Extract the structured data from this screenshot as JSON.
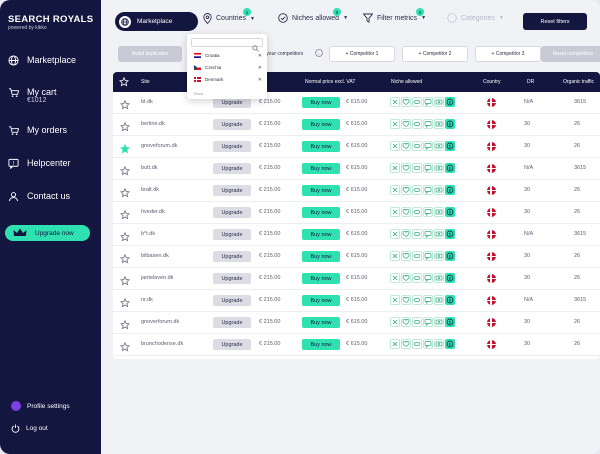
{
  "brand": {
    "name": "SEARCH ROYALS",
    "tagline": "powered by kikko"
  },
  "sidebar": {
    "items": [
      {
        "label": "Marketplace",
        "icon": "globe-icon"
      },
      {
        "label": "My cart",
        "sub": "€1012",
        "icon": "cart-icon"
      },
      {
        "label": "My orders",
        "icon": "orders-cart-icon"
      },
      {
        "label": "Helpcenter",
        "icon": "help-chat-icon"
      },
      {
        "label": "Contact  us",
        "icon": "user-icon"
      }
    ],
    "upgrade": "Upgrade now",
    "profile": "Profile settings",
    "logout": "Log out"
  },
  "topbar": {
    "marketplace_tab": "Marketplace",
    "countries": {
      "label": "Countries",
      "badge": "1"
    },
    "niches": {
      "label": "Niches allowed",
      "badge": "0"
    },
    "metrics": {
      "label": "Filter metrics",
      "badge": "0"
    },
    "categories": {
      "label": "Categories"
    },
    "reset": "Reset filters"
  },
  "secondary": {
    "avoid": "Avoid duplicates",
    "competitors_label": "Add your competitors",
    "competitors": [
      "+ Competitor 1",
      "+ Competitor 2",
      "+ Competitor 3"
    ],
    "reset": "Reset competitors"
  },
  "dropdown": {
    "items": [
      {
        "label": "Croatia",
        "flag_colors": [
          "#ff0000",
          "#ffffff",
          "#171796"
        ]
      },
      {
        "label": "Czechia",
        "flag_colors": [
          "#ffffff",
          "#d7141a",
          "#11457e"
        ]
      },
      {
        "label": "Denmark",
        "flag_colors": [
          "#c8102e",
          "#ffffff"
        ]
      }
    ],
    "reset": "Reset"
  },
  "table": {
    "headers": {
      "site": "Site",
      "price": "Normal price excl. VAT",
      "niches": "Niche allowed",
      "country": "Country",
      "dr": "DR",
      "traffic": "Organic traffic"
    },
    "rows": [
      {
        "site": "bt.dk",
        "price_old": "€ 215.00",
        "price": "€ 615.00",
        "dr": "N/A",
        "traffic": "3615",
        "fav": false
      },
      {
        "site": "berline.dk",
        "price_old": "€ 215.00",
        "price": "€ 615.00",
        "dr": "30",
        "traffic": "26",
        "fav": false
      },
      {
        "site": "gnoveforum.dk",
        "price_old": "€ 215.00",
        "price": "€ 615.00",
        "dr": "30",
        "traffic": "26",
        "fav": true
      },
      {
        "site": "butt.dk",
        "price_old": "€ 215.00",
        "price": "€ 615.00",
        "dr": "N/A",
        "traffic": "3615",
        "fav": false
      },
      {
        "site": "bralt.dk",
        "price_old": "€ 215.00",
        "price": "€ 615.00",
        "dr": "30",
        "traffic": "26",
        "fav": false
      },
      {
        "site": "hveder.dk",
        "price_old": "€ 215.00",
        "price": "€ 615.00",
        "dr": "30",
        "traffic": "26",
        "fav": false
      },
      {
        "site": "b*t.dk",
        "price_old": "€ 215.00",
        "price": "€ 615.00",
        "dr": "N/A",
        "traffic": "3615",
        "fav": false
      },
      {
        "site": "bilbasen.dk",
        "price_old": "€ 215.00",
        "price": "€ 615.00",
        "dr": "30",
        "traffic": "26",
        "fav": false
      },
      {
        "site": "jantelaven.dk",
        "price_old": "€ 215.00",
        "price": "€ 615.00",
        "dr": "30",
        "traffic": "26",
        "fav": false
      },
      {
        "site": "nr.dk",
        "price_old": "€ 215.00",
        "price": "€ 615.00",
        "dr": "N/A",
        "traffic": "3615",
        "fav": false
      },
      {
        "site": "gnoverforum.dk",
        "price_old": "€ 215.00",
        "price": "€ 615.00",
        "dr": "30",
        "traffic": "26",
        "fav": false
      },
      {
        "site": "brunchodense.dk",
        "price_old": "€ 215.00",
        "price": "€ 615.00",
        "dr": "30",
        "traffic": "26",
        "fav": false
      }
    ],
    "upgrade_label": "Upgrade",
    "buy_label": "Buy now",
    "niche_icons": [
      "casino-icon",
      "heart-icon",
      "pill-icon",
      "chat-icon",
      "money-icon",
      "crypto-icon"
    ]
  },
  "colors": {
    "navy": "#13163f",
    "mint": "#2fe0b0",
    "flag_dk": "#c8102e"
  }
}
